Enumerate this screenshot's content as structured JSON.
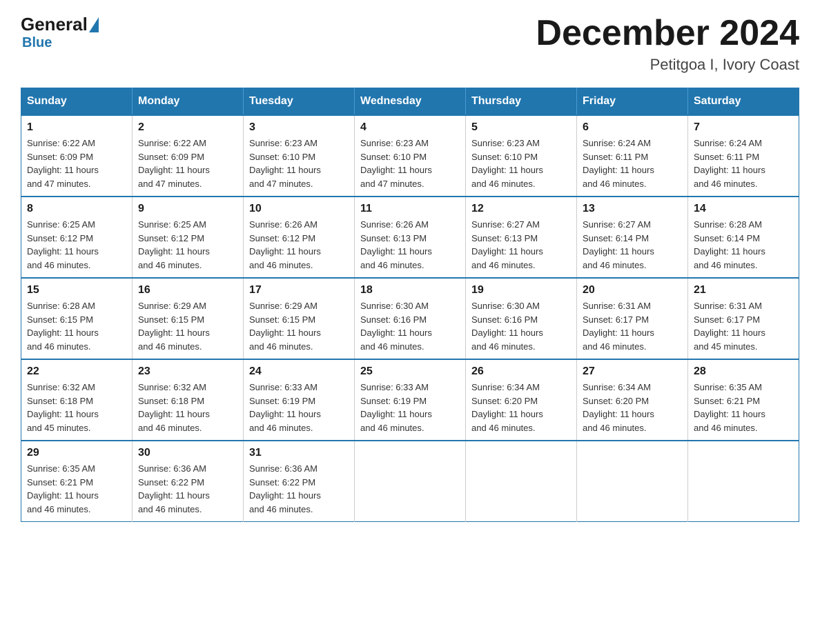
{
  "logo": {
    "general": "General",
    "blue": "Blue"
  },
  "title": "December 2024",
  "location": "Petitgoa I, Ivory Coast",
  "days_of_week": [
    "Sunday",
    "Monday",
    "Tuesday",
    "Wednesday",
    "Thursday",
    "Friday",
    "Saturday"
  ],
  "weeks": [
    [
      {
        "day": "1",
        "sunrise": "6:22 AM",
        "sunset": "6:09 PM",
        "daylight": "11 hours and 47 minutes."
      },
      {
        "day": "2",
        "sunrise": "6:22 AM",
        "sunset": "6:09 PM",
        "daylight": "11 hours and 47 minutes."
      },
      {
        "day": "3",
        "sunrise": "6:23 AM",
        "sunset": "6:10 PM",
        "daylight": "11 hours and 47 minutes."
      },
      {
        "day": "4",
        "sunrise": "6:23 AM",
        "sunset": "6:10 PM",
        "daylight": "11 hours and 47 minutes."
      },
      {
        "day": "5",
        "sunrise": "6:23 AM",
        "sunset": "6:10 PM",
        "daylight": "11 hours and 46 minutes."
      },
      {
        "day": "6",
        "sunrise": "6:24 AM",
        "sunset": "6:11 PM",
        "daylight": "11 hours and 46 minutes."
      },
      {
        "day": "7",
        "sunrise": "6:24 AM",
        "sunset": "6:11 PM",
        "daylight": "11 hours and 46 minutes."
      }
    ],
    [
      {
        "day": "8",
        "sunrise": "6:25 AM",
        "sunset": "6:12 PM",
        "daylight": "11 hours and 46 minutes."
      },
      {
        "day": "9",
        "sunrise": "6:25 AM",
        "sunset": "6:12 PM",
        "daylight": "11 hours and 46 minutes."
      },
      {
        "day": "10",
        "sunrise": "6:26 AM",
        "sunset": "6:12 PM",
        "daylight": "11 hours and 46 minutes."
      },
      {
        "day": "11",
        "sunrise": "6:26 AM",
        "sunset": "6:13 PM",
        "daylight": "11 hours and 46 minutes."
      },
      {
        "day": "12",
        "sunrise": "6:27 AM",
        "sunset": "6:13 PM",
        "daylight": "11 hours and 46 minutes."
      },
      {
        "day": "13",
        "sunrise": "6:27 AM",
        "sunset": "6:14 PM",
        "daylight": "11 hours and 46 minutes."
      },
      {
        "day": "14",
        "sunrise": "6:28 AM",
        "sunset": "6:14 PM",
        "daylight": "11 hours and 46 minutes."
      }
    ],
    [
      {
        "day": "15",
        "sunrise": "6:28 AM",
        "sunset": "6:15 PM",
        "daylight": "11 hours and 46 minutes."
      },
      {
        "day": "16",
        "sunrise": "6:29 AM",
        "sunset": "6:15 PM",
        "daylight": "11 hours and 46 minutes."
      },
      {
        "day": "17",
        "sunrise": "6:29 AM",
        "sunset": "6:15 PM",
        "daylight": "11 hours and 46 minutes."
      },
      {
        "day": "18",
        "sunrise": "6:30 AM",
        "sunset": "6:16 PM",
        "daylight": "11 hours and 46 minutes."
      },
      {
        "day": "19",
        "sunrise": "6:30 AM",
        "sunset": "6:16 PM",
        "daylight": "11 hours and 46 minutes."
      },
      {
        "day": "20",
        "sunrise": "6:31 AM",
        "sunset": "6:17 PM",
        "daylight": "11 hours and 46 minutes."
      },
      {
        "day": "21",
        "sunrise": "6:31 AM",
        "sunset": "6:17 PM",
        "daylight": "11 hours and 45 minutes."
      }
    ],
    [
      {
        "day": "22",
        "sunrise": "6:32 AM",
        "sunset": "6:18 PM",
        "daylight": "11 hours and 45 minutes."
      },
      {
        "day": "23",
        "sunrise": "6:32 AM",
        "sunset": "6:18 PM",
        "daylight": "11 hours and 46 minutes."
      },
      {
        "day": "24",
        "sunrise": "6:33 AM",
        "sunset": "6:19 PM",
        "daylight": "11 hours and 46 minutes."
      },
      {
        "day": "25",
        "sunrise": "6:33 AM",
        "sunset": "6:19 PM",
        "daylight": "11 hours and 46 minutes."
      },
      {
        "day": "26",
        "sunrise": "6:34 AM",
        "sunset": "6:20 PM",
        "daylight": "11 hours and 46 minutes."
      },
      {
        "day": "27",
        "sunrise": "6:34 AM",
        "sunset": "6:20 PM",
        "daylight": "11 hours and 46 minutes."
      },
      {
        "day": "28",
        "sunrise": "6:35 AM",
        "sunset": "6:21 PM",
        "daylight": "11 hours and 46 minutes."
      }
    ],
    [
      {
        "day": "29",
        "sunrise": "6:35 AM",
        "sunset": "6:21 PM",
        "daylight": "11 hours and 46 minutes."
      },
      {
        "day": "30",
        "sunrise": "6:36 AM",
        "sunset": "6:22 PM",
        "daylight": "11 hours and 46 minutes."
      },
      {
        "day": "31",
        "sunrise": "6:36 AM",
        "sunset": "6:22 PM",
        "daylight": "11 hours and 46 minutes."
      },
      null,
      null,
      null,
      null
    ]
  ],
  "labels": {
    "sunrise": "Sunrise:",
    "sunset": "Sunset:",
    "daylight": "Daylight:"
  }
}
